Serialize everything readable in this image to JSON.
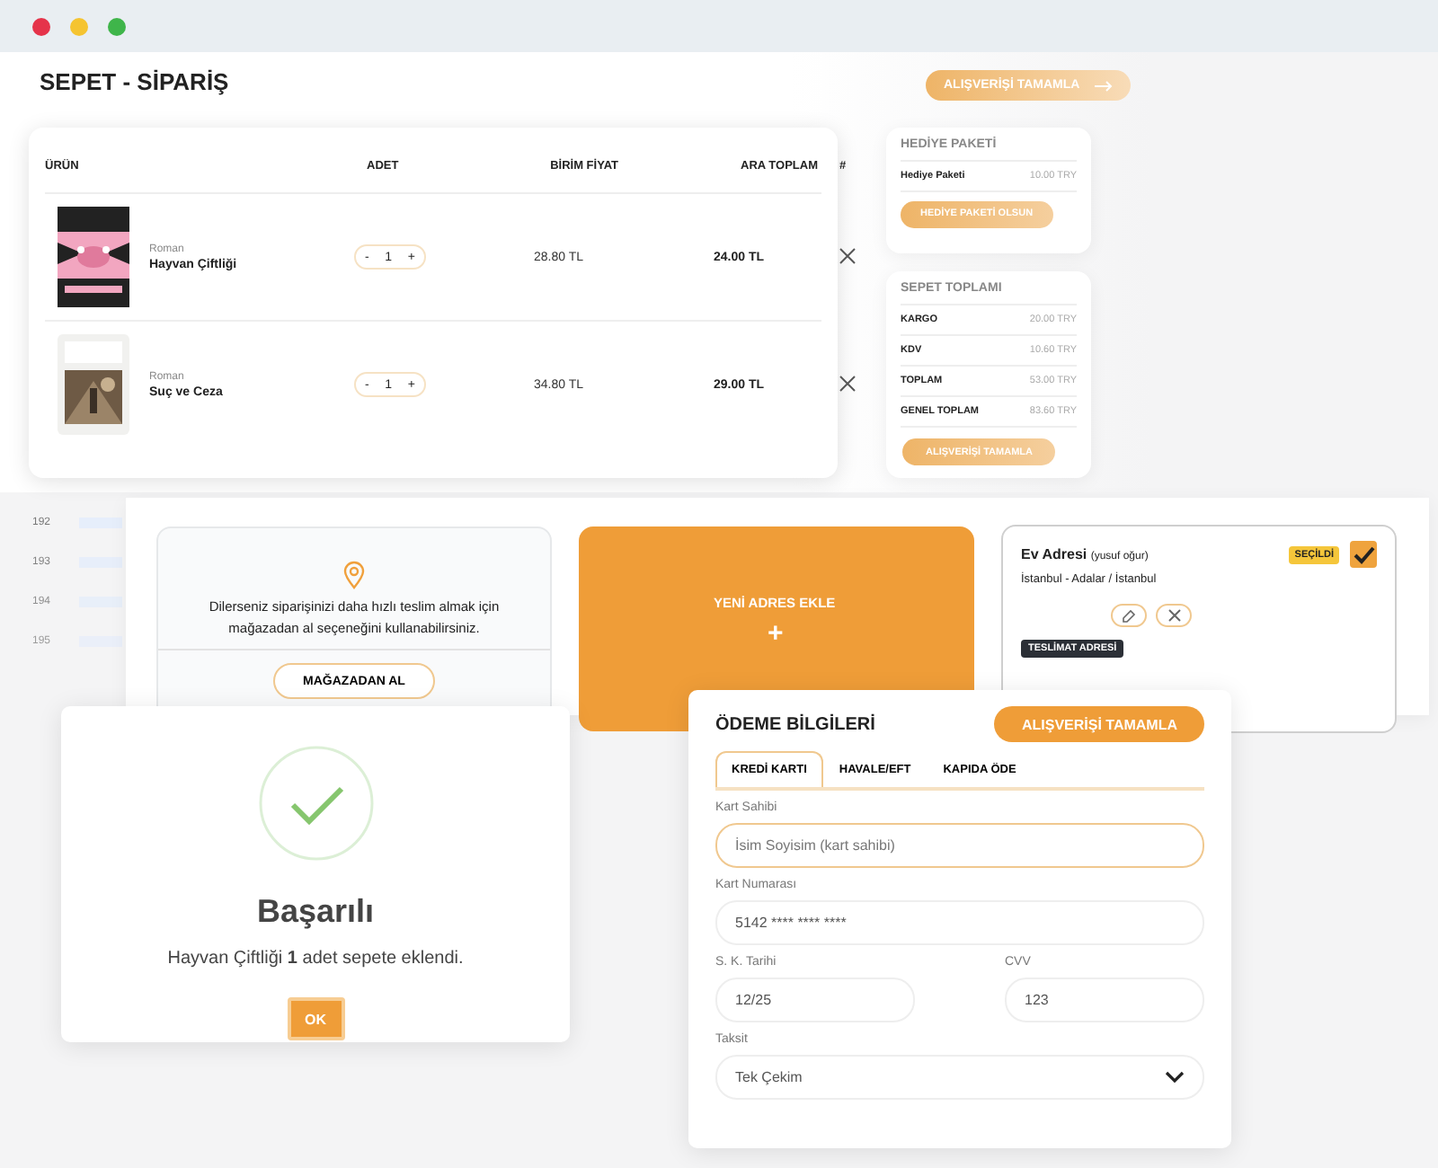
{
  "cart": {
    "title": "SEPET - SİPARİŞ",
    "top_button": "ALIŞVERİŞİ TAMAMLA",
    "columns": [
      "ÜRÜN",
      "ADET",
      "BİRİM FİYAT",
      "ARA TOPLAM",
      "#"
    ],
    "rows": [
      {
        "category": "Roman",
        "name": "Hayvan Çiftliği",
        "minus": "-",
        "quantity": "1",
        "plus": "+",
        "unit_price": "28.80 TL",
        "subtotal": "24.00 TL"
      },
      {
        "category": "Roman",
        "name": "Suç ve Ceza",
        "minus": "-",
        "quantity": "1",
        "plus": "+",
        "unit_price": "34.80 TL",
        "subtotal": "29.00 TL"
      }
    ]
  },
  "gift": {
    "title": "HEDİYE PAKETİ",
    "rows": [
      {
        "label": "Hediye Paketi",
        "value": "10.00 TRY"
      }
    ],
    "button": "HEDİYE PAKETİ OLSUN"
  },
  "totals": {
    "title": "SEPET TOPLAMI",
    "rows": [
      {
        "label": "KARGO",
        "value": "20.00 TRY"
      },
      {
        "label": "KDV",
        "value": "10.60 TRY"
      },
      {
        "label": "TOPLAM",
        "value": "53.00 TRY"
      },
      {
        "label": "GENEL TOPLAM",
        "value": "83.60 TRY"
      }
    ],
    "button": "ALIŞVERİŞİ TAMAMLA"
  },
  "side_list": [
    "192",
    "193",
    "194",
    "195"
  ],
  "store": {
    "text": "Dilerseniz siparişinizi daha hızlı teslim almak için mağazadan al seçeneğini kullanabilirsiniz.",
    "button": "MAĞAZADAN AL"
  },
  "new_address": {
    "label": "YENİ ADRES EKLE",
    "plus": "+"
  },
  "address": {
    "title": "Ev Adresi",
    "owner": "(yusuf oğur)",
    "line": "İstanbul - Adalar / İstanbul",
    "badge": "SEÇİLDİ",
    "selected": true,
    "tag": "TESLİMAT ADRESİ"
  },
  "popup": {
    "title": "Başarılı",
    "message": "Hayvan Çiftliği **1** adet sepete eklendi.",
    "button": "OK"
  },
  "payment": {
    "title": "ÖDEME BİLGİLERİ",
    "button": "ALIŞVERİŞİ TAMAMLA",
    "tabs": [
      {
        "label": "KREDİ KARTI",
        "selected": true
      },
      {
        "label": "HAVALE/EFT",
        "selected": false
      },
      {
        "label": "KAPIDA ÖDE",
        "selected": false
      }
    ],
    "fields": [
      {
        "kind": "wide",
        "label": "Kart Sahibi",
        "placeholder": "İsim Soyisim (kart sahibi)",
        "focused": true
      },
      {
        "kind": "wide",
        "label": "Kart Numarası",
        "value": "5142 **** **** ****",
        "focused": false
      },
      {
        "kind": "half",
        "label": "S. K. Tarihi",
        "value": "12/25",
        "focused": false
      },
      {
        "kind": "half",
        "label": "CVV",
        "value": "123",
        "focused": false
      }
    ],
    "select": {
      "label": "Taksit",
      "value": "Tek Çekim"
    }
  }
}
